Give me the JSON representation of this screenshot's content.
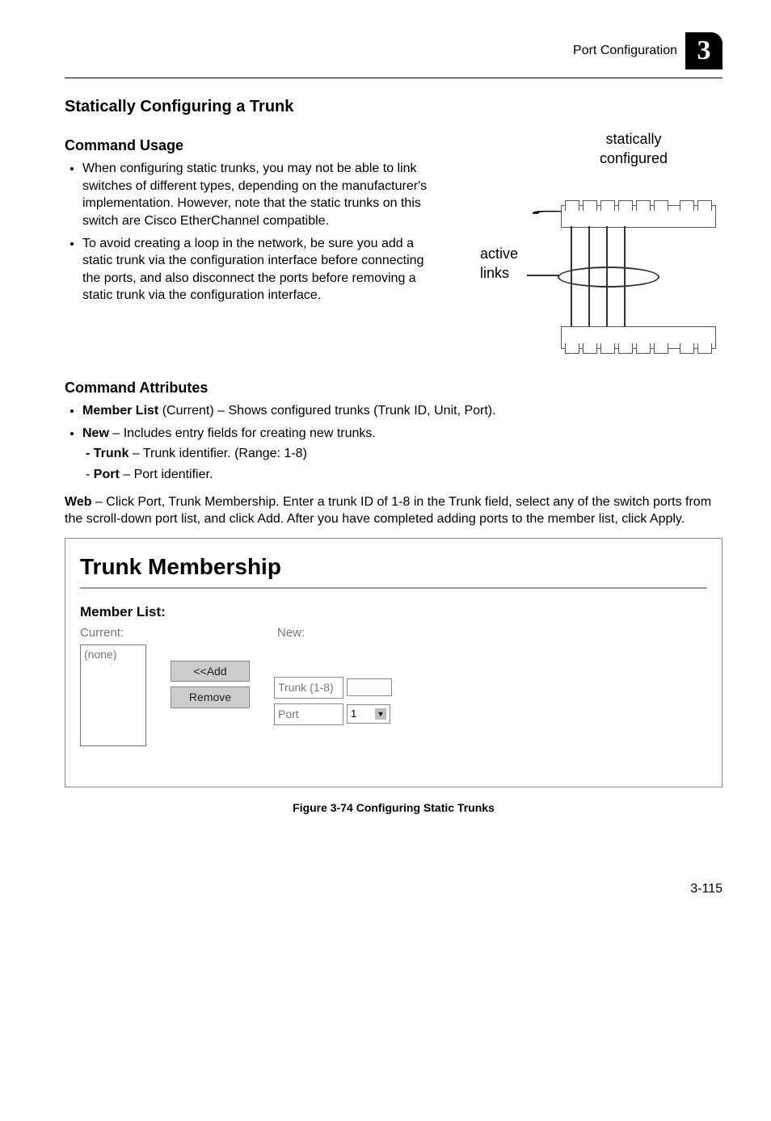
{
  "header": {
    "breadcrumb": "Port Configuration",
    "chapter": "3"
  },
  "section": {
    "title": "Statically Configuring a Trunk",
    "usage_heading": "Command Usage",
    "usage_bullets": [
      "When configuring static trunks, you may not be able to link switches of different types, depending on the manufacturer's implementation. However, note that the static trunks on this switch are Cisco EtherChannel compatible.",
      "To avoid creating a loop in the network, be sure you add a static trunk via the configuration interface before connecting the ports, and also disconnect the ports before removing a static trunk via the configuration interface."
    ],
    "attrs_heading": "Command Attributes",
    "attr_member": {
      "label": "Member List",
      "rest": " (Current) – Shows configured trunks (Trunk ID, Unit, Port)."
    },
    "attr_new": {
      "label": "New",
      "rest": " – Includes entry fields for creating new trunks."
    },
    "attr_trunk": {
      "label": "Trunk",
      "rest": " – Trunk identifier. (Range: 1-8)"
    },
    "attr_port": {
      "label": "Port",
      "rest": " – Port identifier."
    },
    "web_lead": "Web",
    "web_body": " – Click Port, Trunk Membership. Enter a trunk ID of 1-8 in the Trunk field, select any of the switch ports from the scroll-down port list, and click Add. After you have completed adding ports to the member list, click Apply."
  },
  "diagram": {
    "title_line1": "statically",
    "title_line2": "configured",
    "active_line1": "active",
    "active_line2": "links"
  },
  "panel": {
    "title": "Trunk Membership",
    "member_list": "Member List:",
    "current_label": "Current:",
    "current_value": "(none)",
    "new_label": "New:",
    "btn_add": "<<Add",
    "btn_remove": "Remove",
    "trunk_label": "Trunk (1-8)",
    "port_label": "Port",
    "port_value": "1"
  },
  "figure_caption": "Figure 3-74  Configuring Static Trunks",
  "page_number": "3-115"
}
